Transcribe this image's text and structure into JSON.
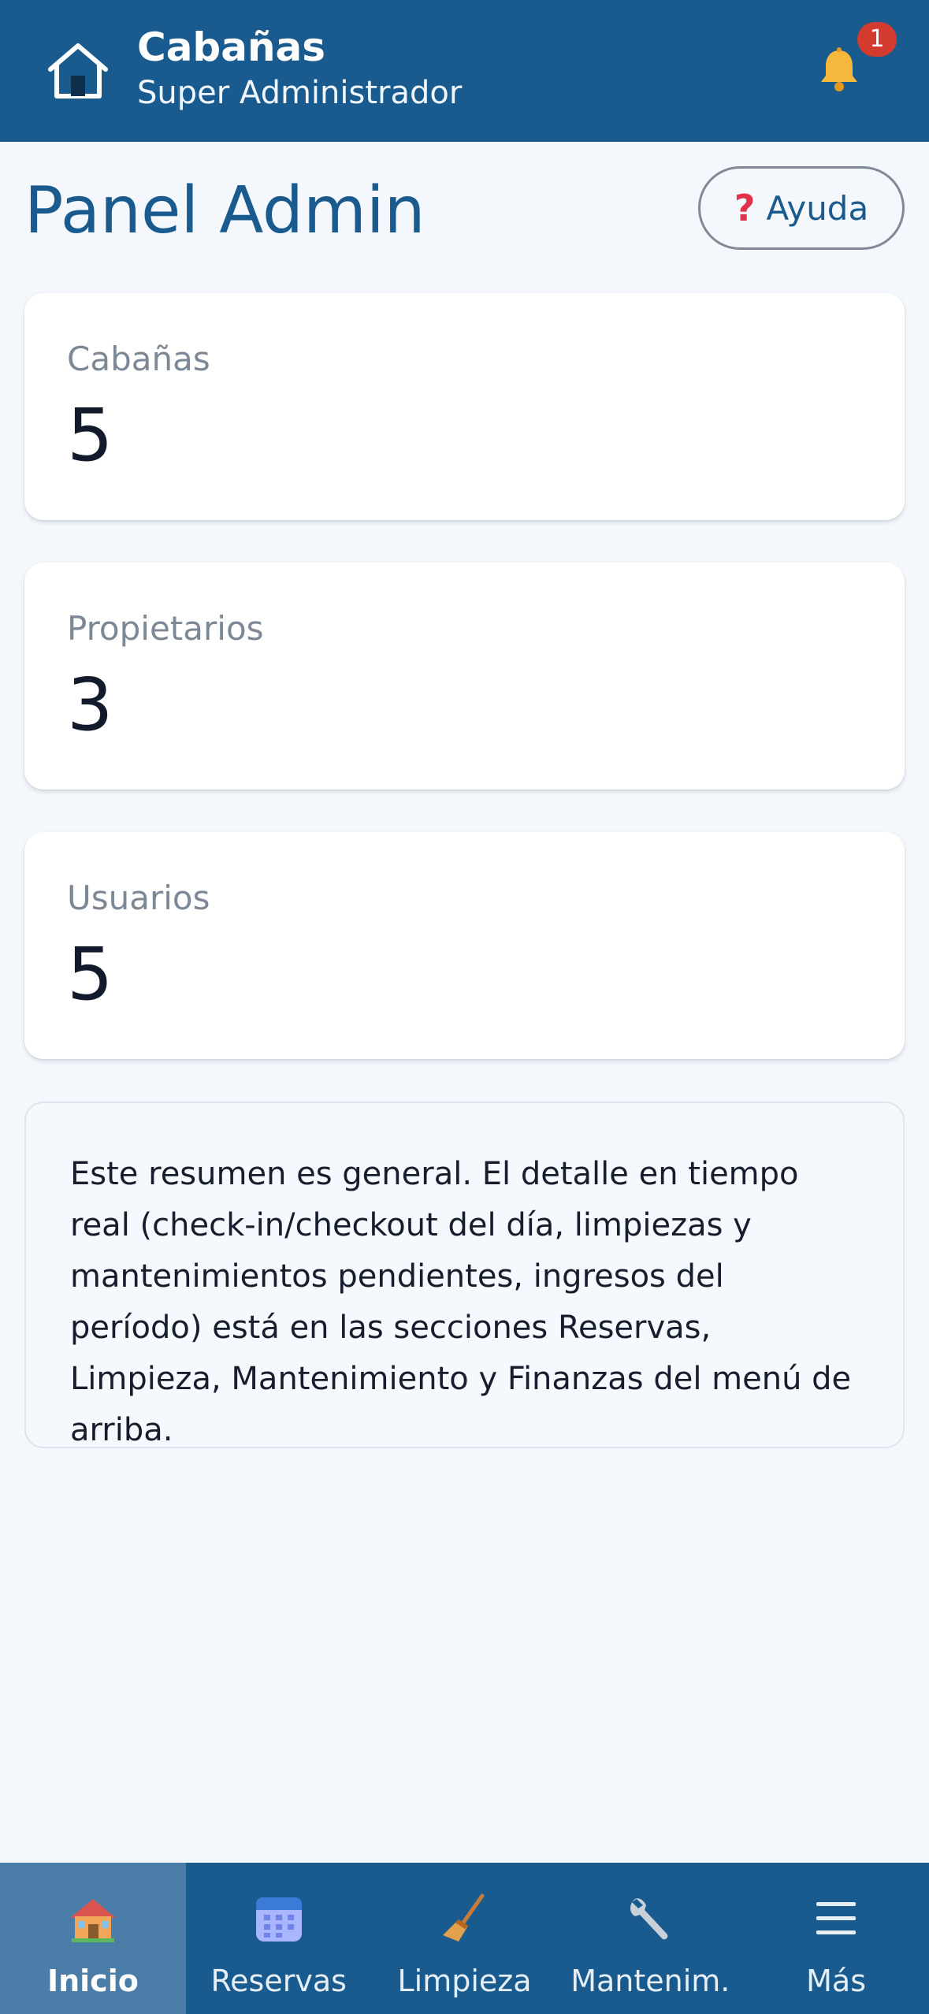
{
  "header": {
    "title": "Cabañas",
    "subtitle": "Super Administrador",
    "notification_count": "1"
  },
  "page": {
    "title": "Panel Admin",
    "help_label": "Ayuda"
  },
  "stats": [
    {
      "label": "Cabañas",
      "value": "5"
    },
    {
      "label": "Propietarios",
      "value": "3"
    },
    {
      "label": "Usuarios",
      "value": "5"
    }
  ],
  "note": {
    "text": "Este resumen es general. El detalle en tiempo real (check-in/checkout del día, limpiezas y mantenimientos pendientes, ingresos del período) está en las secciones Reservas, Limpieza, Mantenimiento y Finanzas del menú de arriba."
  },
  "nav": {
    "items": [
      {
        "label": "Inicio",
        "icon": "house-icon",
        "active": true
      },
      {
        "label": "Reservas",
        "icon": "calendar-icon",
        "active": false
      },
      {
        "label": "Limpieza",
        "icon": "broom-icon",
        "active": false
      },
      {
        "label": "Mantenim.",
        "icon": "wrench-icon",
        "active": false
      },
      {
        "label": "Más",
        "icon": "menu-icon",
        "active": false
      }
    ]
  },
  "colors": {
    "primary": "#1a5b8f",
    "nav_active": "#4a7ea8",
    "badge": "#d33b2f",
    "background": "#f4f7fb"
  }
}
